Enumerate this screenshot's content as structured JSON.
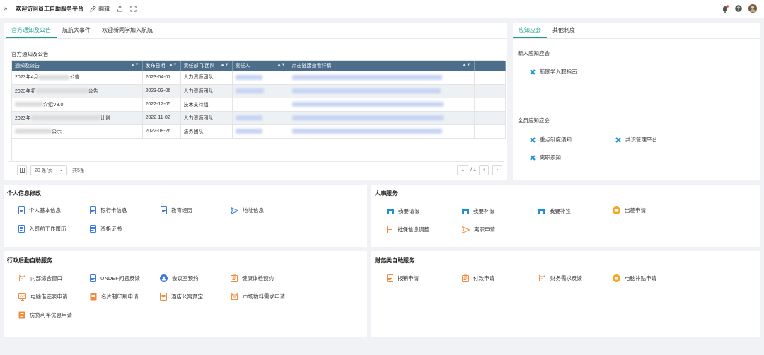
{
  "header": {
    "title": "欢迎访问员工自助服务平台",
    "edit_label": "编辑"
  },
  "notice": {
    "tabs": [
      "官方通知及公告",
      "航航大事件",
      "欢迎新同学加入航航"
    ],
    "section_title": "官方通知及公告",
    "columns": [
      "通知及公告",
      "发布日期",
      "责任部门/团队",
      "责任人",
      "点击链接查看详情",
      ""
    ],
    "rows": [
      {
        "title_start": "2023年4月",
        "title_end": "公告",
        "date": "2023-04-07",
        "dept": "人力资源团队"
      },
      {
        "title_start": "2023年初",
        "title_end": "公告",
        "date": "2023-03-06",
        "dept": "人力资源团队"
      },
      {
        "title_start": "",
        "title_end": "介绍V3.0",
        "date": "2022-12-05",
        "dept": "技术支持组"
      },
      {
        "title_start": "2023年",
        "title_end": "计划",
        "date": "2022-11-02",
        "dept": "人力资源团队"
      },
      {
        "title_start": "",
        "title_end": "公示",
        "date": "2022-08-26",
        "dept": "法务团队"
      }
    ],
    "page_size": "20 条/页",
    "total": "共5条",
    "current_page": "1",
    "total_pages": "/ 1"
  },
  "knowledge": {
    "tabs": [
      "应知应会",
      "其他制度"
    ],
    "newcomer_title": "新人应知应会",
    "newcomer_items": [
      "新同学入职指南"
    ],
    "all_title": "全员应知应会",
    "all_items": [
      "重点制度须知",
      "共识管理平台",
      "离职须知"
    ]
  },
  "personal": {
    "title": "个人信息修改",
    "items": [
      "个人基本信息",
      "银行卡信息",
      "教育经历",
      "地址信息",
      "入司前工作履历",
      "资格证书"
    ]
  },
  "hr": {
    "title": "人事服务",
    "items": [
      "我要请假",
      "我要补假",
      "我要补签",
      "出差申请",
      "社保信息调整",
      "离职申请"
    ]
  },
  "admin": {
    "title": "行政后勤自助服务",
    "items": [
      "内部综合窗口",
      "UNDEF问题反馈",
      "会议室预约",
      "健康体检预约",
      "电脑借还表申请",
      "名片制印刷申请",
      "酒店公寓预定",
      "市场物料需求申请",
      "房贷利率优惠申请"
    ]
  },
  "finance": {
    "title": "财务类自助服务",
    "items": [
      "报销申请",
      "付款申请",
      "财务需求反馈",
      "电脑补贴申请"
    ]
  },
  "colors": {
    "accent": "#1a9f8c",
    "table_header": "#4d6e8a",
    "icon_blue": "#3d7be0",
    "icon_orange": "#f08a3c",
    "icon_teal": "#1d8fd6"
  }
}
